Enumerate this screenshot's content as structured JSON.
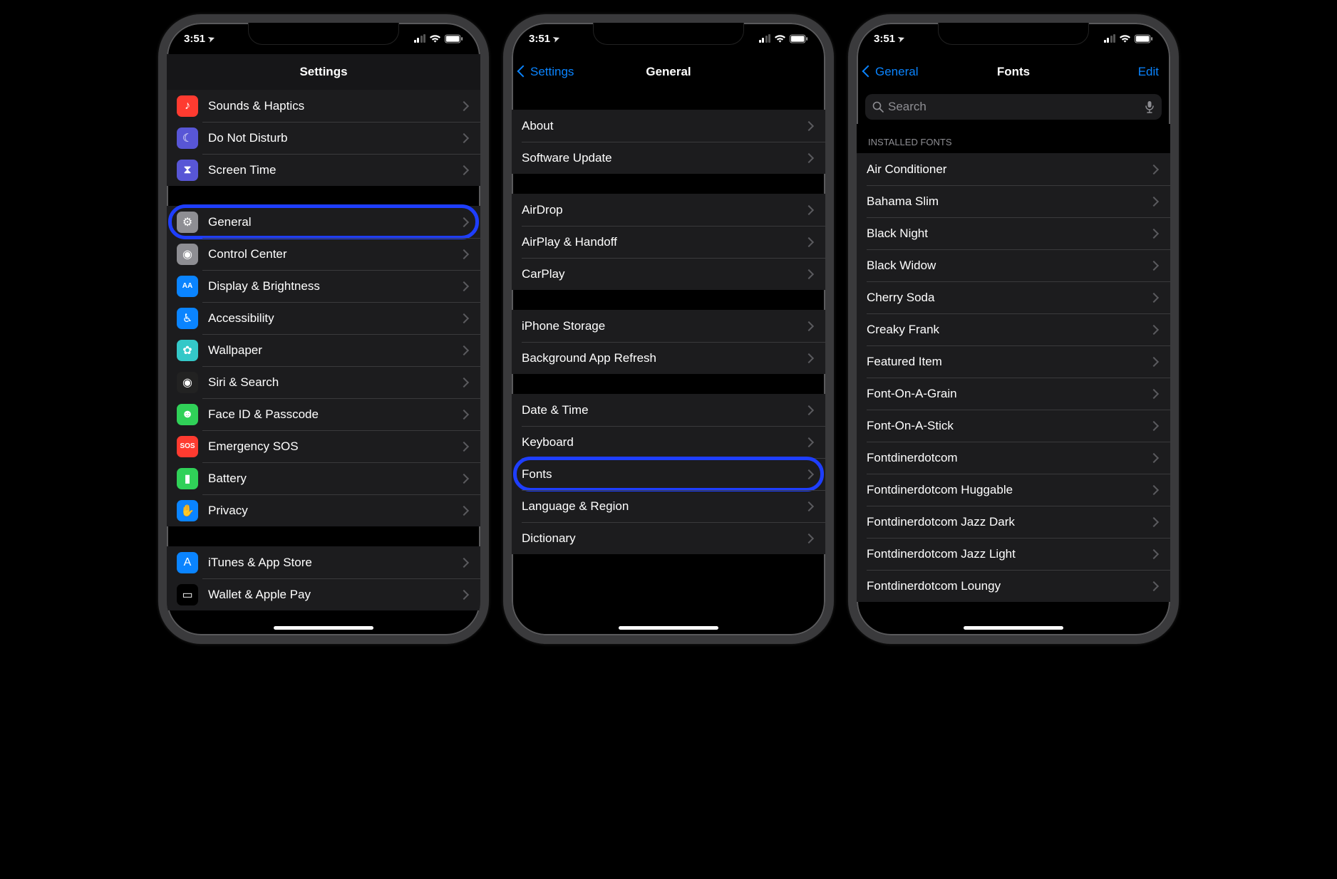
{
  "status": {
    "time": "3:51",
    "loc_glyph": "➤"
  },
  "phone1": {
    "title": "Settings",
    "groups": [
      {
        "tight": true,
        "rows": [
          {
            "icon_bg": "#ff3b30",
            "glyph": "♪",
            "label": "Sounds & Haptics"
          },
          {
            "icon_bg": "#5856d6",
            "glyph": "☾",
            "label": "Do Not Disturb"
          },
          {
            "icon_bg": "#5856d6",
            "glyph": "⧗",
            "label": "Screen Time"
          }
        ]
      },
      {
        "rows": [
          {
            "icon_bg": "#8e8e93",
            "glyph": "⚙︎",
            "label": "General",
            "highlight": true
          },
          {
            "icon_bg": "#8e8e93",
            "glyph": "◉",
            "label": "Control Center"
          },
          {
            "icon_bg": "#0a84ff",
            "glyph": "AA",
            "label": "Display & Brightness",
            "small": true
          },
          {
            "icon_bg": "#0a84ff",
            "glyph": "♿︎",
            "label": "Accessibility"
          },
          {
            "icon_bg": "#34c8c8",
            "glyph": "✿",
            "label": "Wallpaper"
          },
          {
            "icon_bg": "#222",
            "glyph": "◉",
            "label": "Siri & Search"
          },
          {
            "icon_bg": "#30d158",
            "glyph": "☻",
            "label": "Face ID & Passcode"
          },
          {
            "icon_bg": "#ff3b30",
            "glyph": "SOS",
            "label": "Emergency SOS",
            "small": true
          },
          {
            "icon_bg": "#30d158",
            "glyph": "▮",
            "label": "Battery"
          },
          {
            "icon_bg": "#0a84ff",
            "glyph": "✋",
            "label": "Privacy"
          }
        ]
      },
      {
        "rows": [
          {
            "icon_bg": "#0a84ff",
            "glyph": "A",
            "label": "iTunes & App Store"
          },
          {
            "icon_bg": "#000",
            "glyph": "▭",
            "label": "Wallet & Apple Pay"
          }
        ]
      }
    ]
  },
  "phone2": {
    "back": "Settings",
    "title": "General",
    "groups": [
      {
        "rows": [
          {
            "label": "About"
          },
          {
            "label": "Software Update"
          }
        ]
      },
      {
        "rows": [
          {
            "label": "AirDrop"
          },
          {
            "label": "AirPlay & Handoff"
          },
          {
            "label": "CarPlay"
          }
        ]
      },
      {
        "rows": [
          {
            "label": "iPhone Storage"
          },
          {
            "label": "Background App Refresh"
          }
        ]
      },
      {
        "rows": [
          {
            "label": "Date & Time"
          },
          {
            "label": "Keyboard"
          },
          {
            "label": "Fonts",
            "highlight": true
          },
          {
            "label": "Language & Region"
          },
          {
            "label": "Dictionary"
          }
        ]
      }
    ]
  },
  "phone3": {
    "back": "General",
    "title": "Fonts",
    "right": "Edit",
    "search_placeholder": "Search",
    "section_header": "INSTALLED FONTS",
    "fonts": [
      "Air Conditioner",
      "Bahama Slim",
      "Black Night",
      "Black Widow",
      "Cherry Soda",
      "Creaky Frank",
      "Featured Item",
      "Font-On-A-Grain",
      "Font-On-A-Stick",
      "Fontdinerdotcom",
      "Fontdinerdotcom Huggable",
      "Fontdinerdotcom Jazz Dark",
      "Fontdinerdotcom Jazz Light",
      "Fontdinerdotcom Loungy"
    ]
  }
}
